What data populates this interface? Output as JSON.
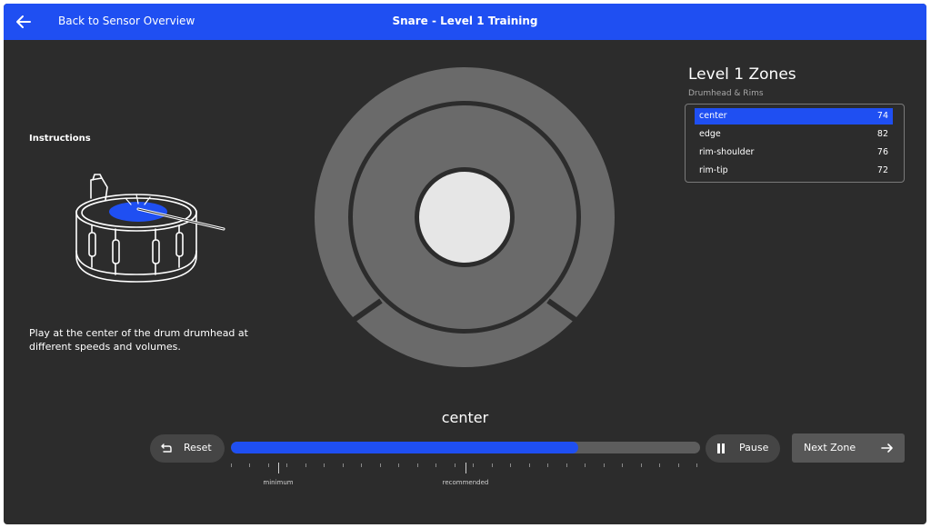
{
  "header": {
    "back_label": "Back to Sensor Overview",
    "title": "Snare - Level 1 Training",
    "back_icon": "arrow-left-icon"
  },
  "instructions": {
    "title": "Instructions",
    "text": "Play at the center of the drum drumhead at different speeds and volumes.",
    "illustration": "snare-drum-with-stick-illustration",
    "highlight_color": "#1f4ff2"
  },
  "target": {
    "selected_zone": "center",
    "zone_color": "#6a6a6a",
    "center_color": "#e6e6e6"
  },
  "zones_panel": {
    "title": "Level 1 Zones",
    "subtitle": "Drumhead & Rims",
    "items": [
      {
        "name": "center",
        "value": "74",
        "selected": true
      },
      {
        "name": "edge",
        "value": "82",
        "selected": false
      },
      {
        "name": "rim-shoulder",
        "value": "76",
        "selected": false
      },
      {
        "name": "rim-tip",
        "value": "72",
        "selected": false
      }
    ]
  },
  "status": {
    "current_zone_label": "center"
  },
  "controls": {
    "reset_label": "Reset",
    "pause_label": "Pause",
    "next_zone_label": "Next Zone",
    "reset_icon": "undo-icon",
    "pause_icon": "pause-icon",
    "next_icon": "arrow-right-icon"
  },
  "progress": {
    "fraction": 0.74,
    "markers": [
      {
        "label": "minimum",
        "fraction": 0.1
      },
      {
        "label": "recommended",
        "fraction": 0.5
      }
    ],
    "accent": "#1f4ff2"
  }
}
